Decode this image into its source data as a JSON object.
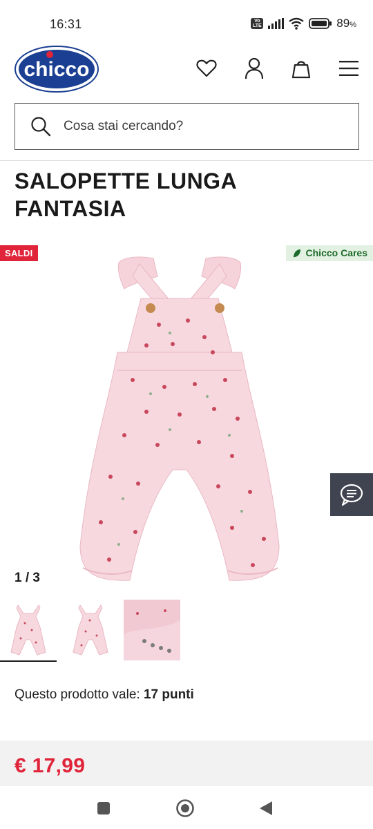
{
  "status_bar": {
    "time": "16:31",
    "volte": "Vo LTE",
    "battery_pct": "89",
    "battery_unit": "%"
  },
  "header": {
    "logo_text": "chicco",
    "icons": [
      "heart-icon",
      "user-icon",
      "bag-icon",
      "menu-icon"
    ]
  },
  "search": {
    "placeholder": "Cosa stai cercando?"
  },
  "product": {
    "title": "SALOPETTE LUNGA FANTASIA",
    "badge_sale": "SALDI",
    "badge_cares": "Chicco Cares",
    "pager": "1 / 3",
    "points_prefix": "Questo prodotto vale:",
    "points_value": "17 punti",
    "price": "€ 17,99"
  },
  "colors": {
    "brand_blue": "#1b3f92",
    "sale_red": "#e0243a",
    "cares_green": "#1d6b2a",
    "garment_pink": "#f7d8df"
  }
}
